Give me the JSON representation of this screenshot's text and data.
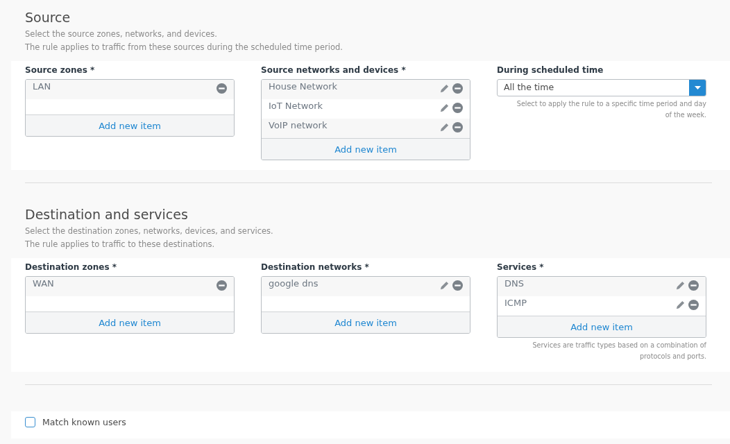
{
  "sections": [
    {
      "title": "Source",
      "description": [
        "Select the source zones, networks, and devices.",
        "The rule applies to traffic from these sources during the scheduled time period."
      ],
      "fields": [
        {
          "kind": "list",
          "label": "Source zones *",
          "items": [
            {
              "text": "LAN",
              "editable": false
            }
          ],
          "add_label": "Add new item"
        },
        {
          "kind": "list",
          "label": "Source networks and devices *",
          "items": [
            {
              "text": "House Network",
              "editable": true
            },
            {
              "text": "IoT Network",
              "editable": true
            },
            {
              "text": "VoIP network",
              "editable": true
            }
          ],
          "add_label": "Add new item"
        },
        {
          "kind": "select",
          "label": "During scheduled time",
          "value": "All the time",
          "hint": "Select to apply the rule to a specific time period and day of the week."
        }
      ]
    },
    {
      "title": "Destination and services",
      "description": [
        "Select the destination zones, networks, devices, and services.",
        "The rule applies to traffic to these destinations."
      ],
      "fields": [
        {
          "kind": "list",
          "label": "Destination zones *",
          "items": [
            {
              "text": "WAN",
              "editable": false
            }
          ],
          "add_label": "Add new item"
        },
        {
          "kind": "list",
          "label": "Destination networks *",
          "items": [
            {
              "text": "google dns",
              "editable": true
            }
          ],
          "add_label": "Add new item"
        },
        {
          "kind": "list",
          "label": "Services *",
          "items": [
            {
              "text": "DNS",
              "editable": true
            },
            {
              "text": "ICMP",
              "editable": true
            }
          ],
          "add_label": "Add new item",
          "hint": "Services are traffic types based on a combination of protocols and ports."
        }
      ]
    }
  ],
  "match_known_users": {
    "label": "Match known users",
    "checked": false
  }
}
